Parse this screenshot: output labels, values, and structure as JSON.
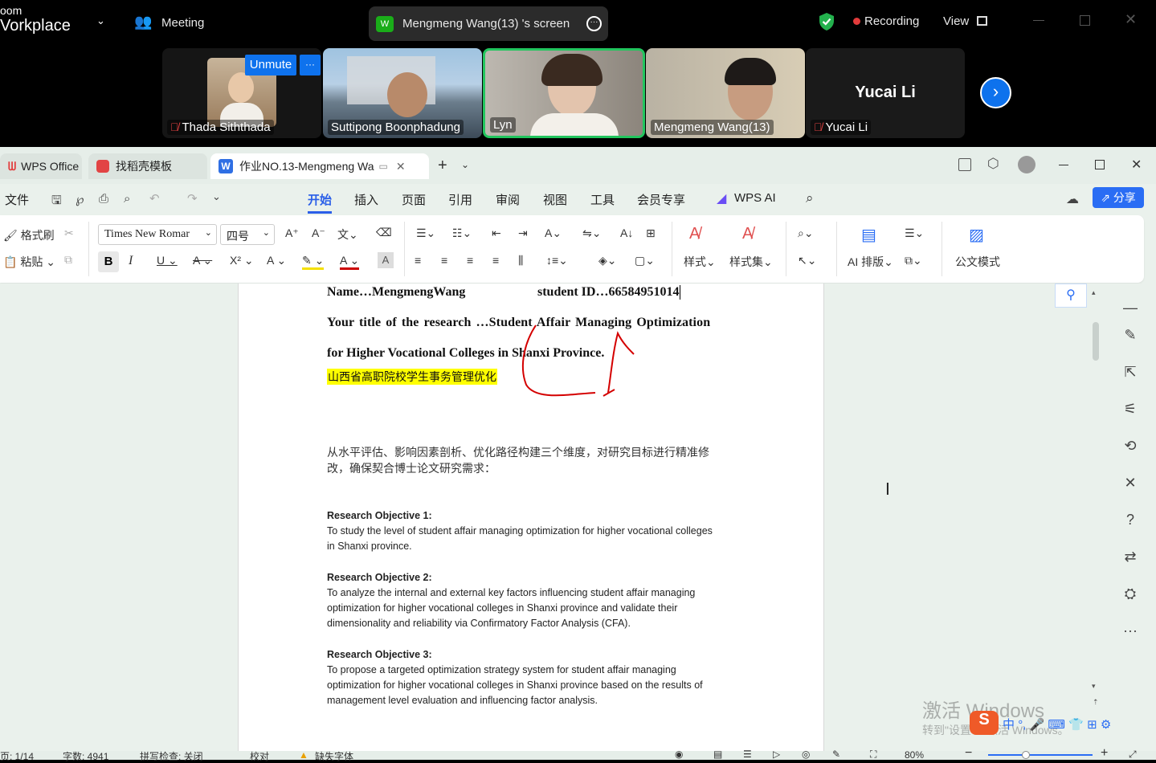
{
  "zoom": {
    "app_title_line1": "oom",
    "app_title_line2": "Vorkplace",
    "meeting_label": "Meeting",
    "screen_share_label": "Mengmeng Wang(13) 's screen",
    "recording_label": "Recording",
    "view_label": "View",
    "unmute_label": "Unmute",
    "more_label": "···",
    "participants": [
      {
        "name": "Thada Siththada",
        "muted": true
      },
      {
        "name": "Suttipong Boonphadung",
        "muted": false
      },
      {
        "name": "Lyn",
        "muted": false
      },
      {
        "name": "Mengmeng Wang(13)",
        "muted": false
      },
      {
        "name": "Yucai Li",
        "muted": true,
        "display_name": "Yucai Li"
      }
    ]
  },
  "wps": {
    "tabs": [
      {
        "label": "WPS Office"
      },
      {
        "label": "找稻壳模板"
      },
      {
        "label": "作业NO.13-Mengmeng Wa"
      }
    ],
    "menu": {
      "file": "文件",
      "items": [
        "开始",
        "插入",
        "页面",
        "引用",
        "审阅",
        "视图",
        "工具",
        "会员专享"
      ],
      "wps_ai": "WPS AI",
      "share": "分享"
    },
    "ribbon": {
      "format_painter": "格式刷",
      "paste": "粘贴",
      "font_name": "Times New Romar",
      "font_size": "四号",
      "styles": "样式",
      "style_set": "样式集",
      "ai_layout": "AI 排版",
      "official_mode": "公文模式"
    },
    "document": {
      "name_line": "Name…MengmengWang",
      "student_id": "student ID…66584951014",
      "title_line1": "Your title of the research …Student Affair Managing Optimization",
      "title_line2": "for Higher Vocational Colleges in Shanxi Province.",
      "chinese_title": "山西省高职院校学生事务管理优化",
      "chinese_para_line1": "从水平评估、影响因素剖析、优化路径构建三个维度，对研究目标进行精准修",
      "chinese_para_line2": "改，确保契合博士论文研究需求：",
      "objectives": [
        {
          "heading": "Research Objective 1:",
          "lines": [
            "To study the level of student affair managing optimization for higher vocational colleges",
            "in Shanxi province."
          ]
        },
        {
          "heading": "Research Objective 2:",
          "lines": [
            "To analyze the internal and external key factors influencing student affair managing",
            "optimization for higher vocational colleges in Shanxi province and validate their",
            "dimensionality and reliability via Confirmatory Factor Analysis (CFA)."
          ]
        },
        {
          "heading": "Research Objective 3:",
          "lines": [
            "To propose a targeted optimization strategy system for student affair managing",
            "optimization for higher vocational colleges in Shanxi province based on the results of",
            "management level evaluation and influencing factor analysis."
          ]
        }
      ]
    },
    "status": {
      "page": "页: 1/14",
      "word_count": "字数: 4941",
      "spell_check": "拼写检查: 关闭",
      "proofread": "校对",
      "missing_font": "缺失字体",
      "zoom": "80%"
    },
    "watermark_line1": "激活 Windows",
    "watermark_line2": "转到\"设置\"以激活 Windows。"
  }
}
